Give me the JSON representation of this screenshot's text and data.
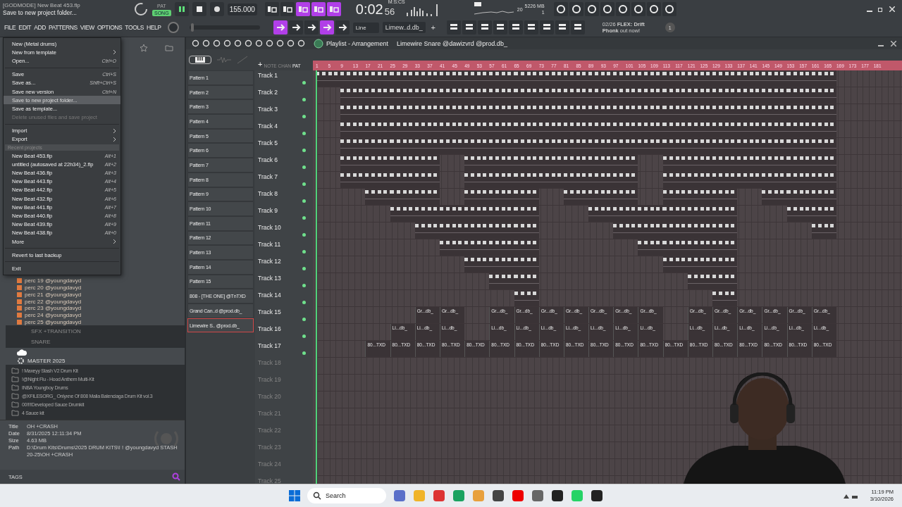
{
  "top_bar": {
    "project_tag": "[GODMODE]",
    "project": "New Beat 453.flp",
    "hint": "Save to new project folder...",
    "modes": [
      {
        "label": "PAT",
        "selected": false
      },
      {
        "label": "SONG",
        "selected": true
      }
    ],
    "playing": true,
    "tempo": "155.000",
    "time_label": "M:S:CS",
    "time": "0:02",
    "time_cs": "56",
    "cpu": "20",
    "memory": "5226 MB",
    "voices": "1",
    "toggles": [
      {
        "on": false
      },
      {
        "on": false
      },
      {
        "on": true
      },
      {
        "on": true
      },
      {
        "on": true
      }
    ]
  },
  "menu_bar": [
    "FILE",
    "EDIT",
    "ADD",
    "PATTERNS",
    "VIEW",
    "OPTIONS",
    "TOOLS",
    "HELP"
  ],
  "tool_bar": {
    "master_pitch": {
      "level": 0.02
    },
    "toggles": [
      {
        "on": true
      },
      {
        "on": false
      },
      {
        "on": false
      },
      {
        "on": true
      },
      {
        "on": false
      }
    ],
    "snap": "Line",
    "pattern": "Limew..d.db_",
    "plus": "+",
    "news": "02/26 **FLEX: Drift Phonk** out now!",
    "news_count": "1"
  },
  "file_menu": [
    {
      "kind": "item",
      "label": "New (Metal drums)",
      "submenu": false,
      "disabled": false,
      "selected": false
    },
    {
      "kind": "item",
      "label": "New from template",
      "submenu": true,
      "disabled": false,
      "selected": false
    },
    {
      "kind": "item",
      "label": "Open...",
      "shortcut": "Ctrl+O",
      "submenu": false,
      "disabled": false,
      "selected": false
    },
    {
      "kind": "separator"
    },
    {
      "kind": "item",
      "label": "Save",
      "shortcut": "Ctrl+S",
      "submenu": false,
      "disabled": false,
      "selected": false
    },
    {
      "kind": "item",
      "label": "Save as...",
      "shortcut": "Shift+Ctrl+S",
      "submenu": false,
      "disabled": false,
      "selected": false
    },
    {
      "kind": "item",
      "label": "Save new version",
      "shortcut": "Ctrl+N",
      "submenu": false,
      "disabled": false,
      "selected": false
    },
    {
      "kind": "item",
      "label": "Save to new project folder...",
      "submenu": false,
      "disabled": false,
      "selected": true
    },
    {
      "kind": "item",
      "label": "Save as template...",
      "submenu": false,
      "disabled": false,
      "selected": false
    },
    {
      "kind": "item",
      "label": "Delete unused files and save project",
      "submenu": false,
      "disabled": true,
      "selected": false
    },
    {
      "kind": "separator"
    },
    {
      "kind": "item",
      "label": "Import",
      "submenu": true,
      "disabled": false,
      "selected": false
    },
    {
      "kind": "item",
      "label": "Export",
      "submenu": true,
      "disabled": false,
      "selected": false
    },
    {
      "kind": "header",
      "label": "Recent projects"
    },
    {
      "kind": "item",
      "label": "New Beat 453.flp",
      "shortcut": "Alt+1",
      "submenu": false,
      "disabled": false,
      "selected": false
    },
    {
      "kind": "item",
      "label": "untitled (autosaved at 22h34)_2.flp",
      "shortcut": "Alt+2",
      "submenu": false,
      "disabled": false,
      "selected": false
    },
    {
      "kind": "item",
      "label": "New Beat 436.flp",
      "shortcut": "Alt+3",
      "submenu": false,
      "disabled": false,
      "selected": false
    },
    {
      "kind": "item",
      "label": "New Beat 443.flp",
      "shortcut": "Alt+4",
      "submenu": false,
      "disabled": false,
      "selected": false
    },
    {
      "kind": "item",
      "label": "New Beat 442.flp",
      "shortcut": "Alt+5",
      "submenu": false,
      "disabled": false,
      "selected": false
    },
    {
      "kind": "item",
      "label": "New Beat 432.flp",
      "shortcut": "Alt+6",
      "submenu": false,
      "disabled": false,
      "selected": false
    },
    {
      "kind": "item",
      "label": "New Beat 441.flp",
      "shortcut": "Alt+7",
      "submenu": false,
      "disabled": false,
      "selected": false
    },
    {
      "kind": "item",
      "label": "New Beat 440.flp",
      "shortcut": "Alt+8",
      "submenu": false,
      "disabled": false,
      "selected": false
    },
    {
      "kind": "item",
      "label": "New Beat 439.flp",
      "shortcut": "Alt+9",
      "submenu": false,
      "disabled": false,
      "selected": false
    },
    {
      "kind": "item",
      "label": "New Beat 438.flp",
      "shortcut": "Alt+0",
      "submenu": false,
      "disabled": false,
      "selected": false
    },
    {
      "kind": "item",
      "label": "More",
      "submenu": true,
      "disabled": false,
      "selected": false
    },
    {
      "kind": "separator"
    },
    {
      "kind": "item",
      "label": "Revert to last backup",
      "submenu": false,
      "disabled": false,
      "selected": false
    },
    {
      "kind": "separator"
    },
    {
      "kind": "item",
      "label": "Exit",
      "submenu": false,
      "disabled": false,
      "selected": false
    }
  ],
  "browser": {
    "samples": [
      "perc 19 @youngdavyd",
      "perc 20 @youngdavyd",
      "perc 21 @youngdavyd",
      "perc 22 @youngdavyd",
      "perc 23 @youngdavyd",
      "perc 24 @youngdavyd",
      "perc 25 @youngdavyd"
    ],
    "collapsed_folders": [
      "SFX +TRANSITION",
      "SNARE"
    ],
    "group": "MASTER 2025",
    "packs": [
      "! Maxeyy Stash V2 Drum Kit",
      "!@Night Flu - Hood Anthem Multi-Kit",
      "INBA Youngboy Drums",
      "@XFILESORG_ Onlyxne Of 808 Malia Balenciaga Drum Kit vol.3",
      "00!!!!Developed Sauce Drumkit",
      "4 Sauce kit"
    ],
    "info": [
      {
        "key": "Title",
        "value": "OH +CRASH"
      },
      {
        "key": "Date",
        "value": "8/31/2025 12:11:34 PM"
      },
      {
        "key": "Size",
        "value": "4.63 MB"
      },
      {
        "key": "Path",
        "value": "D:\\Drum Kits\\Drums\\2025 DRUM KITS\\! ! @youngdavyd STASH 20-25\\OH +CRASH"
      }
    ],
    "tags": "TAGS"
  },
  "playlist": {
    "title": "Playlist - Arrangement",
    "add_track": "+",
    "crumb": "Limewire Snare @dawizvrd @prod.db_",
    "picker_tabs": [
      {
        "label": "NOTE",
        "selected": false
      },
      {
        "label": "CHAN",
        "selected": false
      },
      {
        "label": "PAT",
        "selected": true
      }
    ],
    "patterns": [
      {
        "name": "Pattern 1",
        "selected": false
      },
      {
        "name": "Pattern 2",
        "selected": false
      },
      {
        "name": "Pattern 3",
        "selected": false
      },
      {
        "name": "Pattern 4",
        "selected": false
      },
      {
        "name": "Pattern 5",
        "selected": false
      },
      {
        "name": "Pattern 6",
        "selected": false
      },
      {
        "name": "Pattern 7",
        "selected": false
      },
      {
        "name": "Pattern 8",
        "selected": false
      },
      {
        "name": "Pattern 9",
        "selected": false
      },
      {
        "name": "Pattern 10",
        "selected": false
      },
      {
        "name": "Pattern 11",
        "selected": false
      },
      {
        "name": "Pattern 12",
        "selected": false
      },
      {
        "name": "Pattern 13",
        "selected": false
      },
      {
        "name": "Pattern 14",
        "selected": false
      },
      {
        "name": "Pattern 15",
        "selected": false
      },
      {
        "name": "808 - [THE ONE] @TnTXD",
        "selected": false
      },
      {
        "name": "Grand Can..d @prod.db_",
        "selected": false
      },
      {
        "name": "Limewire S.. @prod.db_",
        "selected": true
      }
    ],
    "ruler": [
      "1",
      "5",
      "9",
      "13",
      "17",
      "21",
      "25",
      "29",
      "33",
      "37",
      "41",
      "45",
      "49",
      "53",
      "57",
      "61",
      "65",
      "69",
      "73",
      "77",
      "81",
      "85",
      "89",
      "93",
      "97",
      "101",
      "105",
      "109",
      "113",
      "117",
      "121",
      "125",
      "129",
      "133",
      "137",
      "141",
      "145",
      "149",
      "153",
      "157",
      "161",
      "165",
      "169",
      "173",
      "177",
      "181"
    ],
    "tracks": [
      {
        "name": "Track 1",
        "empty": false,
        "segments": [
          {
            "kind": "pattern"
          },
          {
            "kind": "pattern"
          },
          {
            "kind": "pattern"
          },
          {
            "kind": "pattern"
          },
          {
            "kind": "pattern"
          },
          {
            "kind": "pattern"
          },
          {
            "kind": "pattern"
          },
          {
            "kind": "pattern"
          },
          {
            "kind": "pattern"
          },
          {
            "kind": "pattern"
          },
          {
            "kind": "pattern"
          },
          {
            "kind": "pattern"
          },
          {
            "kind": "pattern"
          },
          {
            "kind": "pattern"
          },
          {
            "kind": "pattern"
          },
          {
            "kind": "pattern"
          },
          {
            "kind": "pattern"
          },
          {
            "kind": "pattern"
          },
          {
            "kind": "pattern"
          },
          {
            "kind": "pattern"
          },
          {
            "kind": "pattern"
          }
        ]
      },
      {
        "name": "Track 2",
        "empty": false,
        "segments": [
          {
            "kind": "gap"
          },
          {
            "kind": "pattern"
          },
          {
            "kind": "pattern"
          },
          {
            "kind": "pattern"
          },
          {
            "kind": "pattern"
          },
          {
            "kind": "pattern"
          },
          {
            "kind": "pattern"
          },
          {
            "kind": "pattern"
          },
          {
            "kind": "pattern"
          },
          {
            "kind": "pattern"
          },
          {
            "kind": "pattern"
          },
          {
            "kind": "pattern"
          },
          {
            "kind": "pattern"
          },
          {
            "kind": "pattern"
          },
          {
            "kind": "pattern"
          },
          {
            "kind": "pattern"
          },
          {
            "kind": "pattern"
          },
          {
            "kind": "pattern"
          },
          {
            "kind": "pattern"
          },
          {
            "kind": "pattern"
          },
          {
            "kind": "pattern"
          }
        ]
      },
      {
        "name": "Track 3",
        "empty": false,
        "segments": [
          {
            "kind": "gap"
          },
          {
            "kind": "pattern"
          },
          {
            "kind": "pattern"
          },
          {
            "kind": "pattern"
          },
          {
            "kind": "pattern"
          },
          {
            "kind": "pattern"
          },
          {
            "kind": "pattern"
          },
          {
            "kind": "pattern"
          },
          {
            "kind": "pattern"
          },
          {
            "kind": "pattern"
          },
          {
            "kind": "pattern"
          },
          {
            "kind": "pattern"
          },
          {
            "kind": "pattern"
          },
          {
            "kind": "pattern"
          },
          {
            "kind": "pattern"
          },
          {
            "kind": "pattern"
          },
          {
            "kind": "pattern"
          },
          {
            "kind": "pattern"
          },
          {
            "kind": "pattern"
          },
          {
            "kind": "pattern"
          },
          {
            "kind": "pattern"
          }
        ]
      },
      {
        "name": "Track 4",
        "empty": false,
        "segments": [
          {
            "kind": "gap"
          },
          {
            "kind": "pattern"
          },
          {
            "kind": "pattern"
          },
          {
            "kind": "pattern"
          },
          {
            "kind": "pattern"
          },
          {
            "kind": "pattern"
          },
          {
            "kind": "pattern"
          },
          {
            "kind": "pattern"
          },
          {
            "kind": "pattern"
          },
          {
            "kind": "pattern"
          },
          {
            "kind": "pattern"
          },
          {
            "kind": "pattern"
          },
          {
            "kind": "pattern"
          },
          {
            "kind": "pattern"
          },
          {
            "kind": "pattern"
          },
          {
            "kind": "pattern"
          },
          {
            "kind": "pattern"
          },
          {
            "kind": "pattern"
          },
          {
            "kind": "pattern"
          },
          {
            "kind": "pattern"
          },
          {
            "kind": "pattern"
          }
        ]
      },
      {
        "name": "Track 5",
        "empty": false,
        "segments": [
          {
            "kind": "gap"
          },
          {
            "kind": "pattern"
          },
          {
            "kind": "pattern"
          },
          {
            "kind": "pattern"
          },
          {
            "kind": "pattern"
          },
          {
            "kind": "pattern"
          },
          {
            "kind": "pattern"
          },
          {
            "kind": "pattern"
          },
          {
            "kind": "pattern"
          },
          {
            "kind": "pattern"
          },
          {
            "kind": "pattern"
          },
          {
            "kind": "pattern"
          },
          {
            "kind": "pattern"
          },
          {
            "kind": "pattern"
          },
          {
            "kind": "pattern"
          },
          {
            "kind": "pattern"
          },
          {
            "kind": "pattern"
          },
          {
            "kind": "pattern"
          },
          {
            "kind": "pattern"
          },
          {
            "kind": "pattern"
          },
          {
            "kind": "pattern"
          }
        ]
      },
      {
        "name": "Track 6",
        "empty": false,
        "segments": [
          {
            "kind": "gap"
          },
          {
            "kind": "pattern"
          },
          {
            "kind": "pattern"
          },
          {
            "kind": "pattern"
          },
          {
            "kind": "pattern"
          },
          {
            "kind": "gap"
          },
          {
            "kind": "pattern"
          },
          {
            "kind": "pattern"
          },
          {
            "kind": "pattern"
          },
          {
            "kind": "pattern"
          },
          {
            "kind": "pattern"
          },
          {
            "kind": "pattern"
          },
          {
            "kind": "pattern"
          },
          {
            "kind": "gap"
          },
          {
            "kind": "pattern"
          },
          {
            "kind": "pattern"
          },
          {
            "kind": "pattern"
          },
          {
            "kind": "pattern"
          },
          {
            "kind": "pattern"
          },
          {
            "kind": "pattern"
          },
          {
            "kind": "pattern"
          }
        ]
      },
      {
        "name": "Track 7",
        "empty": false,
        "segments": [
          {
            "kind": "gap"
          },
          {
            "kind": "pattern"
          },
          {
            "kind": "pattern"
          },
          {
            "kind": "pattern"
          },
          {
            "kind": "pattern"
          },
          {
            "kind": "gap"
          },
          {
            "kind": "pattern"
          },
          {
            "kind": "pattern"
          },
          {
            "kind": "pattern"
          },
          {
            "kind": "pattern"
          },
          {
            "kind": "pattern"
          },
          {
            "kind": "pattern"
          },
          {
            "kind": "pattern"
          },
          {
            "kind": "gap"
          },
          {
            "kind": "pattern"
          },
          {
            "kind": "pattern"
          },
          {
            "kind": "pattern"
          },
          {
            "kind": "pattern"
          },
          {
            "kind": "pattern"
          },
          {
            "kind": "pattern"
          },
          {
            "kind": "pattern"
          }
        ]
      },
      {
        "name": "Track 8",
        "empty": false,
        "segments": [
          {
            "kind": "gap"
          },
          {
            "kind": "gap"
          },
          {
            "kind": "pattern"
          },
          {
            "kind": "pattern"
          },
          {
            "kind": "pattern"
          },
          {
            "kind": "gap"
          },
          {
            "kind": "pattern"
          },
          {
            "kind": "pattern"
          },
          {
            "kind": "pattern"
          },
          {
            "kind": "gap"
          },
          {
            "kind": "pattern"
          },
          {
            "kind": "pattern"
          },
          {
            "kind": "pattern"
          },
          {
            "kind": "gap"
          },
          {
            "kind": "pattern"
          },
          {
            "kind": "pattern"
          },
          {
            "kind": "pattern"
          },
          {
            "kind": "gap"
          },
          {
            "kind": "pattern"
          },
          {
            "kind": "pattern"
          },
          {
            "kind": "pattern"
          }
        ]
      },
      {
        "name": "Track 9",
        "empty": false,
        "segments": [
          {
            "kind": "gap"
          },
          {
            "kind": "gap"
          },
          {
            "kind": "gap"
          },
          {
            "kind": "pattern"
          },
          {
            "kind": "pattern"
          },
          {
            "kind": "pattern"
          },
          {
            "kind": "pattern"
          },
          {
            "kind": "pattern"
          },
          {
            "kind": "pattern"
          },
          {
            "kind": "gap"
          },
          {
            "kind": "gap"
          },
          {
            "kind": "pattern"
          },
          {
            "kind": "pattern"
          },
          {
            "kind": "pattern"
          },
          {
            "kind": "pattern"
          },
          {
            "kind": "pattern"
          },
          {
            "kind": "pattern"
          },
          {
            "kind": "gap"
          },
          {
            "kind": "gap"
          },
          {
            "kind": "pattern"
          },
          {
            "kind": "pattern"
          }
        ]
      },
      {
        "name": "Track 10",
        "empty": false,
        "segments": [
          {
            "kind": "gap"
          },
          {
            "kind": "gap"
          },
          {
            "kind": "gap"
          },
          {
            "kind": "gap"
          },
          {
            "kind": "pattern"
          },
          {
            "kind": "pattern"
          },
          {
            "kind": "pattern"
          },
          {
            "kind": "pattern"
          },
          {
            "kind": "pattern"
          },
          {
            "kind": "gap"
          },
          {
            "kind": "gap"
          },
          {
            "kind": "gap"
          },
          {
            "kind": "pattern"
          },
          {
            "kind": "pattern"
          },
          {
            "kind": "pattern"
          },
          {
            "kind": "pattern"
          },
          {
            "kind": "pattern"
          },
          {
            "kind": "gap"
          },
          {
            "kind": "gap"
          },
          {
            "kind": "gap"
          },
          {
            "kind": "pattern"
          }
        ]
      },
      {
        "name": "Track 11",
        "empty": false,
        "segments": [
          {
            "kind": "gap"
          },
          {
            "kind": "gap"
          },
          {
            "kind": "gap"
          },
          {
            "kind": "gap"
          },
          {
            "kind": "gap"
          },
          {
            "kind": "pattern"
          },
          {
            "kind": "pattern"
          },
          {
            "kind": "pattern"
          },
          {
            "kind": "pattern"
          },
          {
            "kind": "gap"
          },
          {
            "kind": "gap"
          },
          {
            "kind": "gap"
          },
          {
            "kind": "gap"
          },
          {
            "kind": "pattern"
          },
          {
            "kind": "pattern"
          },
          {
            "kind": "pattern"
          },
          {
            "kind": "pattern"
          }
        ]
      },
      {
        "name": "Track 12",
        "empty": false,
        "segments": [
          {
            "kind": "gap"
          },
          {
            "kind": "gap"
          },
          {
            "kind": "gap"
          },
          {
            "kind": "gap"
          },
          {
            "kind": "gap"
          },
          {
            "kind": "gap"
          },
          {
            "kind": "pattern"
          },
          {
            "kind": "pattern"
          },
          {
            "kind": "pattern"
          },
          {
            "kind": "gap"
          },
          {
            "kind": "gap"
          },
          {
            "kind": "gap"
          },
          {
            "kind": "gap"
          },
          {
            "kind": "gap"
          },
          {
            "kind": "pattern"
          },
          {
            "kind": "pattern"
          },
          {
            "kind": "pattern"
          }
        ]
      },
      {
        "name": "Track 13",
        "empty": false,
        "segments": [
          {
            "kind": "gap"
          },
          {
            "kind": "gap"
          },
          {
            "kind": "gap"
          },
          {
            "kind": "gap"
          },
          {
            "kind": "gap"
          },
          {
            "kind": "gap"
          },
          {
            "kind": "gap"
          },
          {
            "kind": "pattern"
          },
          {
            "kind": "pattern"
          },
          {
            "kind": "gap"
          },
          {
            "kind": "gap"
          },
          {
            "kind": "gap"
          },
          {
            "kind": "gap"
          },
          {
            "kind": "gap"
          },
          {
            "kind": "gap"
          },
          {
            "kind": "pattern"
          },
          {
            "kind": "pattern"
          }
        ]
      },
      {
        "name": "Track 14",
        "empty": false,
        "segments": [
          {
            "kind": "gap"
          },
          {
            "kind": "gap"
          },
          {
            "kind": "gap"
          },
          {
            "kind": "gap"
          },
          {
            "kind": "gap"
          },
          {
            "kind": "gap"
          },
          {
            "kind": "gap"
          },
          {
            "kind": "gap"
          },
          {
            "kind": "pattern"
          },
          {
            "kind": "gap"
          },
          {
            "kind": "gap"
          },
          {
            "kind": "gap"
          },
          {
            "kind": "gap"
          },
          {
            "kind": "gap"
          },
          {
            "kind": "gap"
          },
          {
            "kind": "gap"
          },
          {
            "kind": "pattern"
          }
        ]
      },
      {
        "name": "Track 15",
        "empty": false,
        "segments": [
          {
            "kind": "gap"
          },
          {
            "kind": "gap"
          },
          {
            "kind": "gap"
          },
          {
            "kind": "gap"
          },
          {
            "kind": "clip",
            "label": "Gr...db_"
          },
          {
            "kind": "clip",
            "label": "Gr...db_"
          },
          {
            "kind": "gap"
          },
          {
            "kind": "clip",
            "label": "Gr...db_"
          },
          {
            "kind": "clip",
            "label": "Gr...db_"
          },
          {
            "kind": "clip",
            "label": "Gr...db_"
          },
          {
            "kind": "clip",
            "label": "Gr...db_"
          },
          {
            "kind": "clip",
            "label": "Gr...db_"
          },
          {
            "kind": "clip",
            "label": "Gr...db_"
          },
          {
            "kind": "clip",
            "label": "Gr...db_"
          },
          {
            "kind": "gap"
          },
          {
            "kind": "clip",
            "label": "Gr...db_"
          },
          {
            "kind": "clip",
            "label": "Gr...db_"
          },
          {
            "kind": "clip",
            "label": "Gr...db_"
          },
          {
            "kind": "clip",
            "label": "Gr...db_"
          },
          {
            "kind": "clip",
            "label": "Gr...db_"
          },
          {
            "kind": "clip",
            "label": "Gr...db_"
          }
        ]
      },
      {
        "name": "Track 16",
        "empty": false,
        "segments": [
          {
            "kind": "gap"
          },
          {
            "kind": "gap"
          },
          {
            "kind": "gap"
          },
          {
            "kind": "clip",
            "label": "Li...db_"
          },
          {
            "kind": "clip",
            "label": "Li...db_"
          },
          {
            "kind": "clip",
            "label": "Li...db_"
          },
          {
            "kind": "gap"
          },
          {
            "kind": "clip",
            "label": "Li...db_"
          },
          {
            "kind": "clip",
            "label": "Li...db_"
          },
          {
            "kind": "clip",
            "label": "Li...db_"
          },
          {
            "kind": "clip",
            "label": "Li...db_"
          },
          {
            "kind": "clip",
            "label": "Li...db_"
          },
          {
            "kind": "clip",
            "label": "Li...db_"
          },
          {
            "kind": "clip",
            "label": "Li...db_"
          },
          {
            "kind": "gap"
          },
          {
            "kind": "clip",
            "label": "Li...db_"
          },
          {
            "kind": "clip",
            "label": "Li...db_"
          },
          {
            "kind": "clip",
            "label": "Li...db_"
          },
          {
            "kind": "clip",
            "label": "Li...db_"
          },
          {
            "kind": "clip",
            "label": "Li...db_"
          },
          {
            "kind": "clip",
            "label": "Li...db_"
          }
        ]
      },
      {
        "name": "Track 17",
        "empty": false,
        "segments": [
          {
            "kind": "gap"
          },
          {
            "kind": "gap"
          },
          {
            "kind": "clip",
            "label": "80...TXD"
          },
          {
            "kind": "clip",
            "label": "80...TXD"
          },
          {
            "kind": "clip",
            "label": "80...TXD"
          },
          {
            "kind": "clip",
            "label": "80...TXD"
          },
          {
            "kind": "clip",
            "label": "80...TXD"
          },
          {
            "kind": "clip",
            "label": "80...TXD"
          },
          {
            "kind": "clip",
            "label": "80...TXD"
          },
          {
            "kind": "clip",
            "label": "80...TXD"
          },
          {
            "kind": "clip",
            "label": "80...TXD"
          },
          {
            "kind": "clip",
            "label": "80...TXD"
          },
          {
            "kind": "clip",
            "label": "80...TXD"
          },
          {
            "kind": "clip",
            "label": "80...TXD"
          },
          {
            "kind": "clip",
            "label": "80...TXD"
          },
          {
            "kind": "clip",
            "label": "80...TXD"
          },
          {
            "kind": "clip",
            "label": "80...TXD"
          },
          {
            "kind": "clip",
            "label": "80...TXD"
          },
          {
            "kind": "clip",
            "label": "80...TXD"
          },
          {
            "kind": "clip",
            "label": "80...TXD"
          },
          {
            "kind": "clip",
            "label": "80...TXD"
          }
        ]
      },
      {
        "name": "Track 18",
        "empty": true
      },
      {
        "name": "Track 19",
        "empty": true
      },
      {
        "name": "Track 20",
        "empty": true
      },
      {
        "name": "Track 21",
        "empty": true
      },
      {
        "name": "Track 22",
        "empty": true
      },
      {
        "name": "Track 23",
        "empty": true
      },
      {
        "name": "Track 24",
        "empty": true
      },
      {
        "name": "Track 25",
        "empty": true
      }
    ]
  },
  "taskbar": {
    "search": "Search",
    "time": "11:19 PM",
    "date": "3/10/2026"
  }
}
